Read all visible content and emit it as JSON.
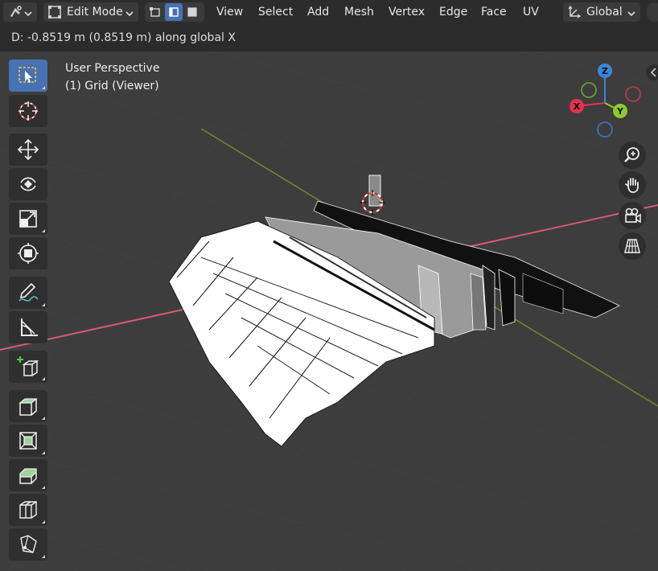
{
  "header": {
    "mode": "Edit Mode",
    "menus": [
      "View",
      "Select",
      "Add",
      "Mesh",
      "Vertex",
      "Edge",
      "Face",
      "UV"
    ],
    "transform_orientation": "Global",
    "select_modes": [
      "vertex-select",
      "edge-select",
      "face-select"
    ],
    "active_select_mode": "edge-select"
  },
  "status": {
    "text": "D: -0.8519 m (0.8519 m) along global X"
  },
  "viewport": {
    "perspective": "User Perspective",
    "object": "(1) Grid (Viewer)"
  },
  "gizmo": {
    "x_label": "X",
    "y_label": "Y",
    "z_label": "Z",
    "x_color": "#e5314d",
    "y_color": "#8bcc2a",
    "z_color": "#3b86d9"
  },
  "toolbar": {
    "tools": [
      "select-box",
      "cursor",
      "move",
      "rotate",
      "scale",
      "transform",
      "annotate",
      "measure",
      "add-cube",
      "extrude-region",
      "inset-faces",
      "bevel",
      "loop-cut",
      "knife"
    ],
    "active_tool": "select-box"
  },
  "colors": {
    "header_bg": "#2c2c2c",
    "viewport_bg": "#3d3d3d",
    "accent": "#4772b3",
    "x_axis": "#d65a6f",
    "y_axis": "#6f8a2a"
  }
}
